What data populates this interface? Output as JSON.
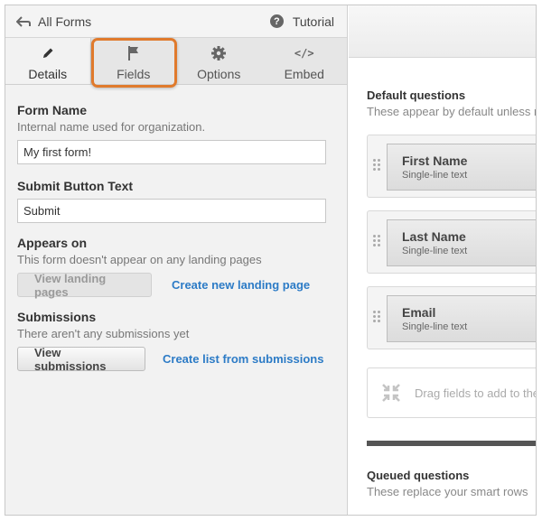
{
  "topbar": {
    "back_label": "All Forms",
    "tutorial_label": "Tutorial",
    "help_glyph": "?"
  },
  "tabs": [
    {
      "label": "Details",
      "icon": "pencil-icon",
      "active": true
    },
    {
      "label": "Fields",
      "icon": "flag-icon",
      "active": false
    },
    {
      "label": "Options",
      "icon": "gear-icon",
      "active": false
    },
    {
      "label": "Embed",
      "icon": "code-icon",
      "glyph": "</>",
      "active": false
    }
  ],
  "form_name": {
    "label": "Form Name",
    "help": "Internal name used for organization.",
    "value": "My first form!"
  },
  "submit_button": {
    "label": "Submit Button Text",
    "value": "Submit"
  },
  "appears_on": {
    "label": "Appears on",
    "help": "This form doesn't appear on any landing pages",
    "button": "View landing pages",
    "link": "Create new landing page"
  },
  "submissions": {
    "label": "Submissions",
    "help": "There aren't any submissions yet",
    "button": "View submissions",
    "link": "Create list from submissions"
  },
  "default_questions": {
    "title": "Default questions",
    "subtitle": "These appear by default unless r",
    "fields": [
      {
        "name": "First Name",
        "type": "Single-line text"
      },
      {
        "name": "Last Name",
        "type": "Single-line text"
      },
      {
        "name": "Email",
        "type": "Single-line text"
      }
    ],
    "drop_hint": "Drag fields to add to the"
  },
  "queued_questions": {
    "title": "Queued questions",
    "subtitle": "These replace your smart rows"
  },
  "colors": {
    "highlight": "#e07a2c",
    "link": "#2c7bc6"
  }
}
